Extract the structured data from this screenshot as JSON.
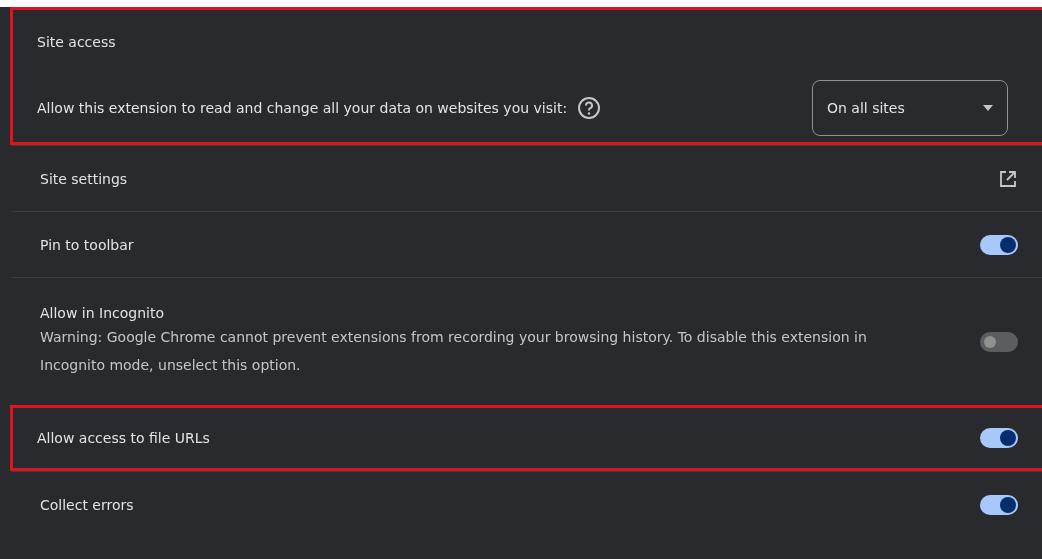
{
  "site_access": {
    "title": "Site access",
    "description": "Allow this extension to read and change all your data on websites you visit:",
    "dropdown": {
      "value": "On all sites"
    },
    "highlighted": true
  },
  "rows": [
    {
      "kind": "link",
      "label": "Site settings",
      "highlighted": false
    },
    {
      "kind": "toggle",
      "label": "Pin to toolbar",
      "on": true,
      "highlighted": false
    },
    {
      "kind": "toggle",
      "label": "Allow in Incognito",
      "description": "Warning: Google Chrome cannot prevent extensions from recording your browsing history. To disable this extension in Incognito mode, unselect this option.",
      "on": false,
      "highlighted": false
    },
    {
      "kind": "toggle",
      "label": "Allow access to file URLs",
      "on": true,
      "highlighted": true
    },
    {
      "kind": "toggle",
      "label": "Collect errors",
      "on": true,
      "highlighted": false
    }
  ]
}
